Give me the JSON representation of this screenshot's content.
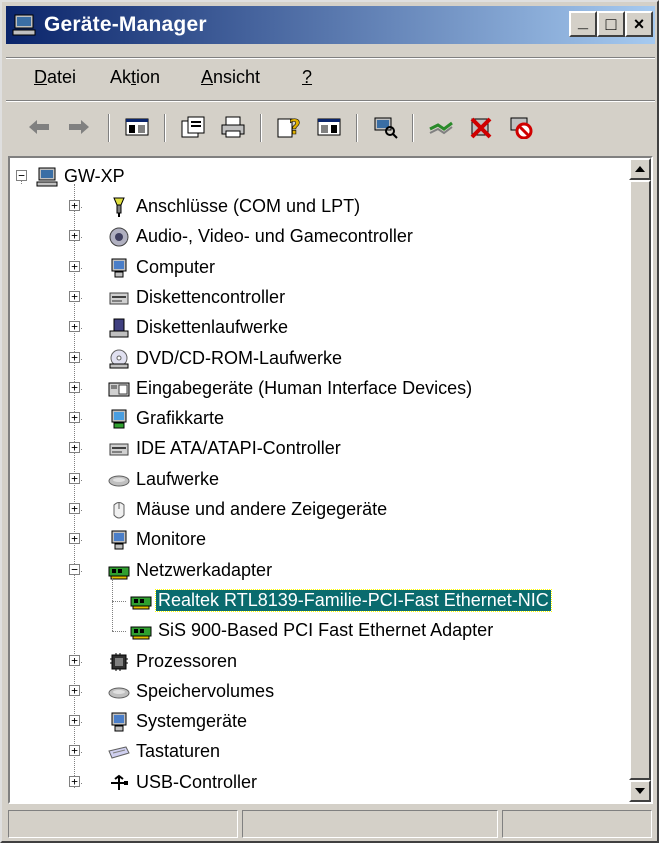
{
  "window": {
    "title": "Geräte-Manager",
    "caption_buttons": {
      "minimize": "_",
      "maximize": "□",
      "close": "×"
    }
  },
  "menubar": {
    "items": [
      {
        "label": "Datei",
        "accel": "D"
      },
      {
        "label": "Aktion",
        "accel": "t"
      },
      {
        "label": "Ansicht",
        "accel": "A"
      },
      {
        "label": "?",
        "accel": "?"
      }
    ]
  },
  "toolbar": {
    "buttons": [
      "back-icon",
      "forward-icon",
      "show-hide-console-tree-icon",
      "properties-icon",
      "print-icon",
      "help-icon",
      "show-hide-action-pane-icon",
      "scan-hardware-icon",
      "update-driver-icon",
      "uninstall-icon",
      "disable-icon"
    ]
  },
  "tree": {
    "root": {
      "label": "GW-XP",
      "icon": "computer-icon"
    },
    "categories": [
      {
        "label": "Anschlüsse (COM und LPT)",
        "icon": "port-icon"
      },
      {
        "label": "Audio-, Video- und Gamecontroller",
        "icon": "speaker-icon"
      },
      {
        "label": "Computer",
        "icon": "computer-icon"
      },
      {
        "label": "Diskettencontroller",
        "icon": "floppy-controller-icon"
      },
      {
        "label": "Diskettenlaufwerke",
        "icon": "floppy-drive-icon"
      },
      {
        "label": "DVD/CD-ROM-Laufwerke",
        "icon": "cd-drive-icon"
      },
      {
        "label": "Eingabegeräte (Human Interface Devices)",
        "icon": "hid-icon"
      },
      {
        "label": "Grafikkarte",
        "icon": "display-adapter-icon"
      },
      {
        "label": "IDE ATA/ATAPI-Controller",
        "icon": "ide-controller-icon"
      },
      {
        "label": "Laufwerke",
        "icon": "disk-drive-icon"
      },
      {
        "label": "Mäuse und andere Zeigegeräte",
        "icon": "mouse-icon"
      },
      {
        "label": "Monitore",
        "icon": "monitor-icon"
      },
      {
        "label": "Netzwerkadapter",
        "icon": "network-adapter-icon",
        "expanded": true,
        "children": [
          {
            "label": "Realtek RTL8139-Familie-PCI-Fast Ethernet-NIC",
            "selected": true
          },
          {
            "label": "SiS 900-Based PCI Fast Ethernet Adapter",
            "selected": false
          }
        ]
      },
      {
        "label": "Prozessoren",
        "icon": "processor-icon"
      },
      {
        "label": "Speichervolumes",
        "icon": "storage-volume-icon"
      },
      {
        "label": "Systemgeräte",
        "icon": "system-device-icon"
      },
      {
        "label": "Tastaturen",
        "icon": "keyboard-icon"
      },
      {
        "label": "USB-Controller",
        "icon": "usb-icon"
      }
    ],
    "expander_expanded": "−",
    "expander_collapsed": "+"
  },
  "colors": {
    "titlebar_start": "#0a246a",
    "titlebar_end": "#a6caf0",
    "selection": "#0a6b6e",
    "chrome": "#d4d0c8"
  }
}
